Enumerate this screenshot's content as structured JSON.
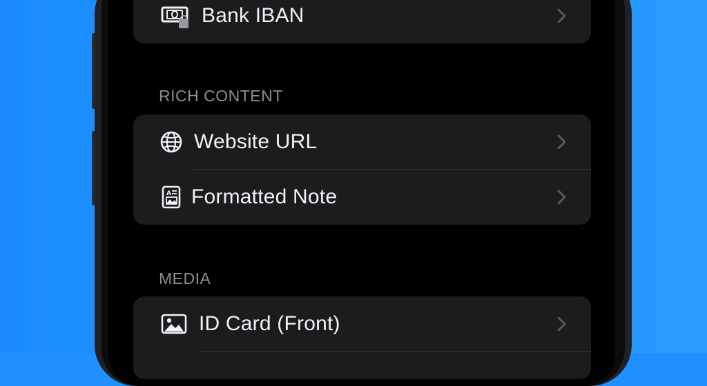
{
  "colors": {
    "background": "#1e90ff",
    "screen": "#000000",
    "card": "#1c1c1e",
    "label": "#f2f2f7",
    "section_header": "#8e8e93",
    "chevron": "#5a5a5f",
    "divider": "#38383a"
  },
  "top_card": {
    "items": [
      {
        "label": "Bank IBAN",
        "icon": "banknote-icon"
      }
    ]
  },
  "rich_content": {
    "header": "RICH CONTENT",
    "items": [
      {
        "label": "Website URL",
        "icon": "globe-icon"
      },
      {
        "label": "Formatted Note",
        "icon": "note-icon"
      }
    ]
  },
  "media": {
    "header": "MEDIA",
    "items": [
      {
        "label": "ID Card (Front)",
        "icon": "photo-icon"
      }
    ]
  }
}
